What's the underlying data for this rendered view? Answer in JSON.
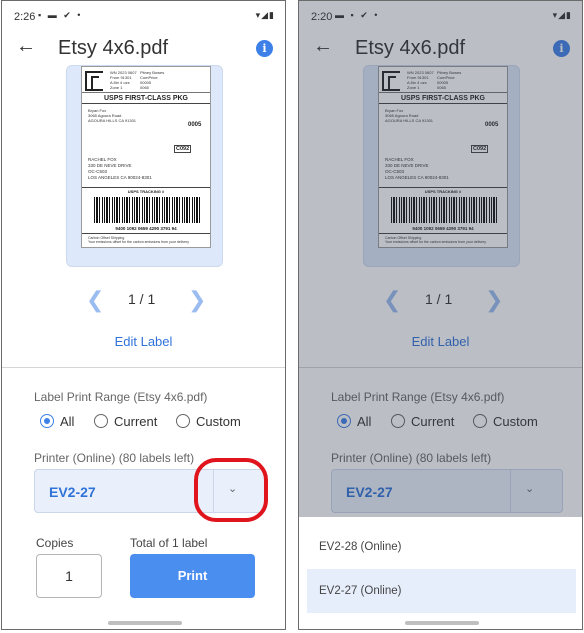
{
  "left": {
    "status": {
      "time": "2:26",
      "left_icons": "▪ ▬ ✔ •",
      "right_icons": "▾◢▮"
    },
    "title": "Etsy 4x6.pdf",
    "label": {
      "head_left": "WN 2023 0607\nFrom 91301\nA 8in 4 ozs\nZone 1",
      "head_right": "Pitney Bowes\nComPrice\n00005\n0065",
      "service": "USPS FIRST-CLASS PKG",
      "from": "Bryan Fox\n3065 Agoura Road\nAGOURA HILLS CA 91301",
      "zone": "0005",
      "code": "C092",
      "to": "RACHEL FOX\n330 DE NEVE DRIVE\nOC-C503\nLOS ANGELES CA 90024-8301",
      "tracking_title": "USPS TRACKING #",
      "tracking_number": "9400 1092 0659 4290 3791 94",
      "footer": "Carbon Offset Shipping\nYour emissions offset for the carbon emissions from your delivery"
    },
    "pager": {
      "prev": "❮",
      "text": "1 / 1",
      "next": "❯"
    },
    "edit_label": "Edit Label",
    "range_label": "Label Print Range (Etsy 4x6.pdf)",
    "range_options": [
      "All",
      "Current",
      "Custom"
    ],
    "printer_label": "Printer (Online) (80 labels left)",
    "printer_value": "EV2-27",
    "copies_label": "Copies",
    "copies_value": "1",
    "total_label": "Total of 1 label",
    "print_button": "Print"
  },
  "right": {
    "status": {
      "time": "2:20",
      "left_icons": "▬ ▪ ✔ •",
      "right_icons": "▾◢▮"
    },
    "title": "Etsy 4x6.pdf",
    "pager": {
      "prev": "❮",
      "text": "1 / 1",
      "next": "❯"
    },
    "edit_label": "Edit Label",
    "range_label": "Label Print Range (Etsy 4x6.pdf)",
    "range_options": [
      "All",
      "Current",
      "Custom"
    ],
    "printer_label": "Printer (Online) (80 labels left)",
    "printer_value": "EV2-27",
    "dropdown_options": [
      "EV2-28 (Online)",
      "EV2-27 (Online)"
    ]
  },
  "icons": {
    "back": "←",
    "info": "i",
    "chevron": "⌄"
  },
  "colors": {
    "accent": "#3d80e8",
    "print_button": "#4a8ef0",
    "highlight": "#e0141c",
    "select_bg": "#eaf0fb"
  }
}
